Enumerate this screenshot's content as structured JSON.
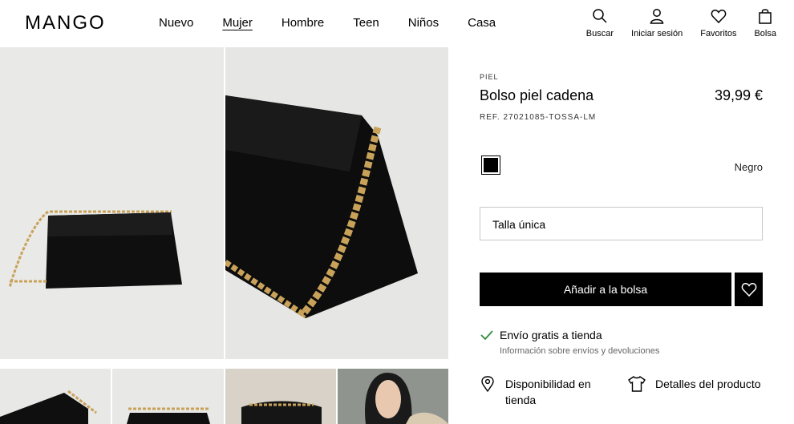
{
  "header": {
    "logo": "MANGO",
    "nav": [
      "Nuevo",
      "Mujer",
      "Hombre",
      "Teen",
      "Niños",
      "Casa"
    ],
    "active_nav": "Mujer",
    "tools": {
      "search": "Buscar",
      "login": "Iniciar sesión",
      "favorites": "Favoritos",
      "bag": "Bolsa"
    }
  },
  "product": {
    "category": "PIEL",
    "name": "Bolso piel cadena",
    "price": "39,99 €",
    "ref": "REF. 27021085-TOSSA-LM",
    "color": {
      "name": "Negro",
      "swatch": "#000000"
    },
    "size": "Talla única",
    "add_to_bag": "Añadir a la bolsa",
    "shipping_title": "Envío gratis a tienda",
    "shipping_link": "Información sobre envíos y devoluciones",
    "availability": "Disponibilidad en tienda",
    "details": "Detalles del producto"
  },
  "icons": {
    "search": "search-icon",
    "user": "user-icon",
    "heart": "heart-icon",
    "bag": "shopping-bag-icon",
    "check": "check-icon",
    "location": "location-pin-icon",
    "shirt": "shirt-icon"
  },
  "colors": {
    "accent": "#000000",
    "check": "#2e8b3d",
    "muted": "#666666"
  }
}
